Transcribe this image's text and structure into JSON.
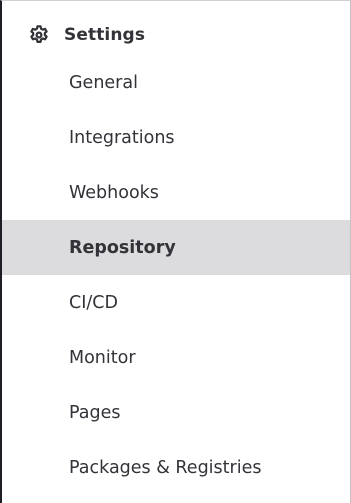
{
  "sidebar": {
    "header": {
      "label": "Settings",
      "icon": "gear-icon"
    },
    "items": [
      {
        "label": "General",
        "active": false
      },
      {
        "label": "Integrations",
        "active": false
      },
      {
        "label": "Webhooks",
        "active": false
      },
      {
        "label": "Repository",
        "active": true
      },
      {
        "label": "CI/CD",
        "active": false
      },
      {
        "label": "Monitor",
        "active": false
      },
      {
        "label": "Pages",
        "active": false
      },
      {
        "label": "Packages & Registries",
        "active": false
      }
    ]
  },
  "colors": {
    "text": "#333238",
    "active_background": "#dcdcde",
    "border": "#1f1e24"
  }
}
